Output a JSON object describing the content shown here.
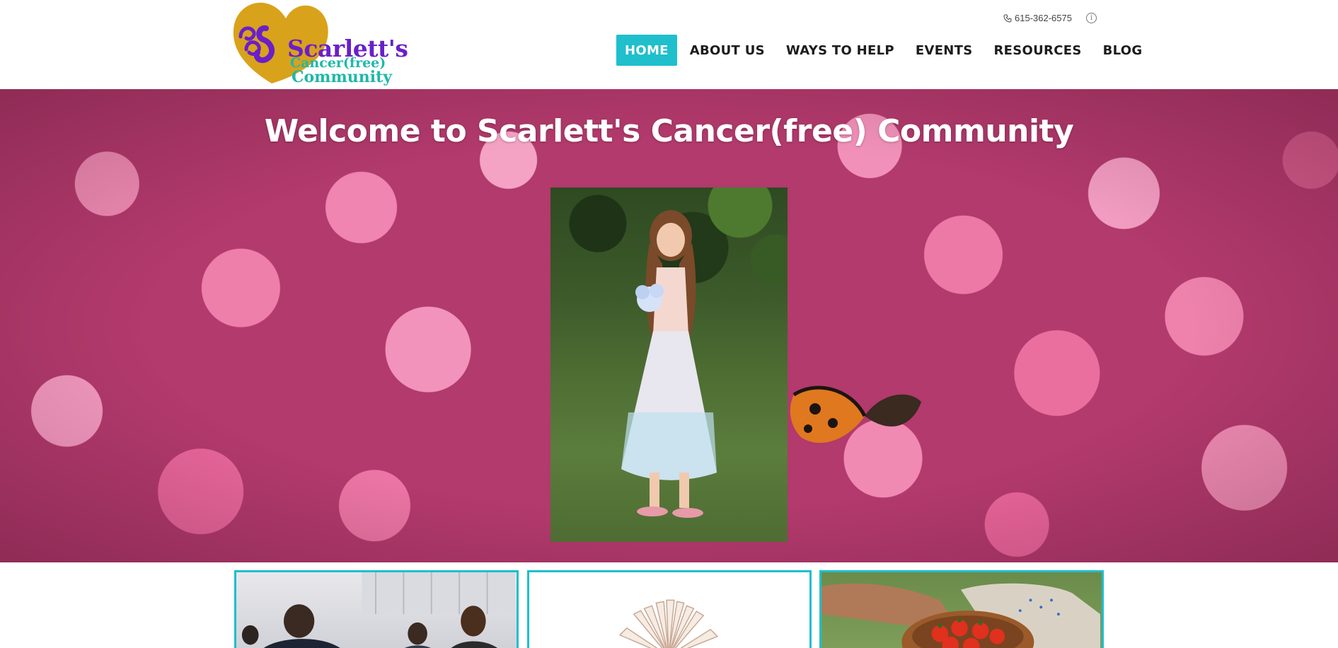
{
  "brand": {
    "logo_line1": "Scarlett's",
    "logo_line2": "Cancer(free)",
    "logo_line3": "Community",
    "colors": {
      "accent": "#1fbfcc",
      "logo_purple": "#6a1fc9",
      "logo_gold": "#d9a21b",
      "logo_teal": "#1fb8a8"
    }
  },
  "top_bar": {
    "phone": "615-362-6575",
    "phone_icon": "phone-icon",
    "info_icon": "info-icon"
  },
  "nav": {
    "items": [
      {
        "label": "HOME",
        "active": true
      },
      {
        "label": "ABOUT US",
        "active": false
      },
      {
        "label": "WAYS TO HELP",
        "active": false
      },
      {
        "label": "EVENTS",
        "active": false
      },
      {
        "label": "RESOURCES",
        "active": false
      },
      {
        "label": "BLOG",
        "active": false
      }
    ]
  },
  "hero": {
    "title": "Welcome to Scarlett's Cancer(free) Community"
  },
  "cards": [
    {
      "image": "people-gathering-photo"
    },
    {
      "image": "open-book-photo"
    },
    {
      "image": "hands-sharing-tomatoes-photo"
    }
  ]
}
